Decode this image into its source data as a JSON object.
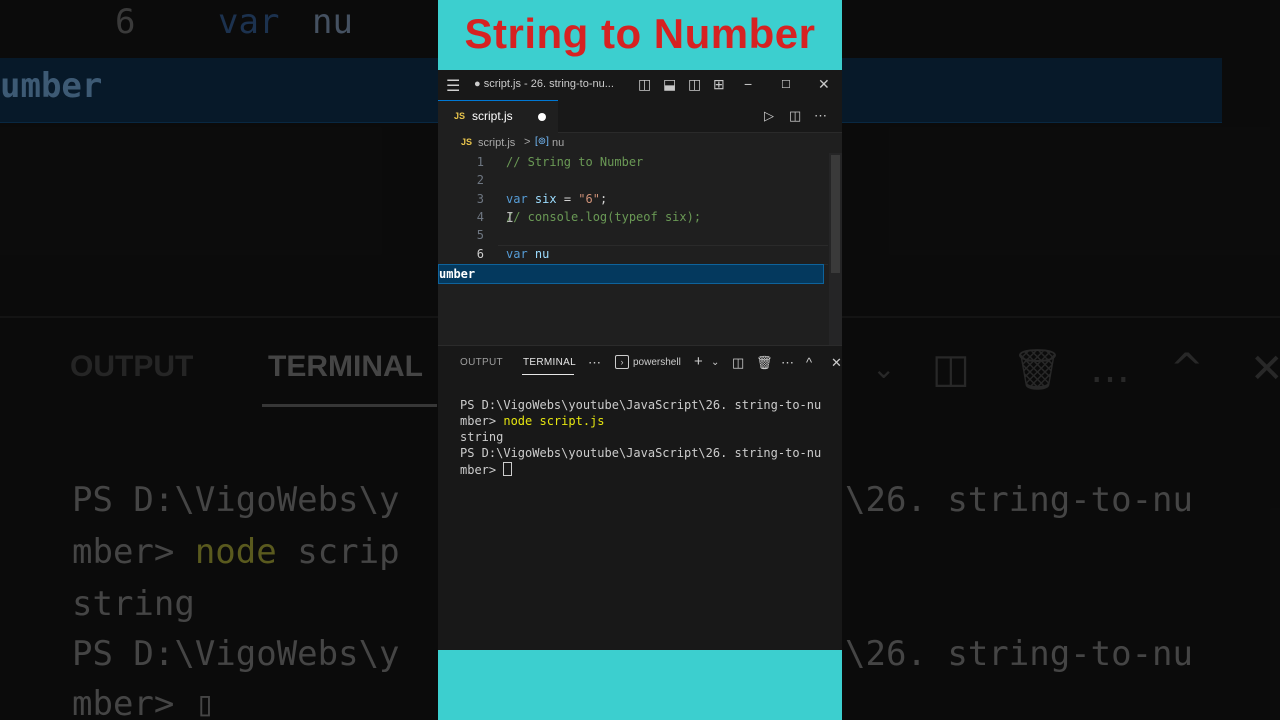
{
  "video": {
    "title": "String to Number"
  },
  "window": {
    "title": "● script.js - 26. string-to-nu..."
  },
  "tab": {
    "label": "script.js",
    "badge": "JS"
  },
  "breadcrumb": {
    "file": "script.js",
    "symbol": "nu",
    "separator": ">"
  },
  "editor": {
    "lines": [
      {
        "num": "1",
        "comment": "// String to Number"
      },
      {
        "num": "2"
      },
      {
        "num": "3",
        "kw": "var",
        "name": "six",
        "op": " = ",
        "str": "\"6\"",
        "end": ";"
      },
      {
        "num": "4",
        "comment": "// console.log(typeof six);"
      },
      {
        "num": "5"
      },
      {
        "num": "6",
        "kw": "var",
        "name": "nu"
      }
    ],
    "suggestion": "umber"
  },
  "panel": {
    "tabs": [
      "OUTPUT",
      "TERMINAL"
    ],
    "active_tab": "TERMINAL",
    "shell": "powershell",
    "terminal": {
      "prompt1_a": "PS D:\\VigoWebs\\youtube\\JavaScript\\26. string-to-nu",
      "prompt1_b": "mber> ",
      "command": "node script.js",
      "output": "string",
      "prompt2_a": "PS D:\\VigoWebs\\youtube\\JavaScript\\26. string-to-nu",
      "prompt2_b": "mber> "
    }
  },
  "colors": {
    "accent_band": "#3ccfcf",
    "title_red": "#d62222",
    "suggest_bg": "#04395e"
  }
}
